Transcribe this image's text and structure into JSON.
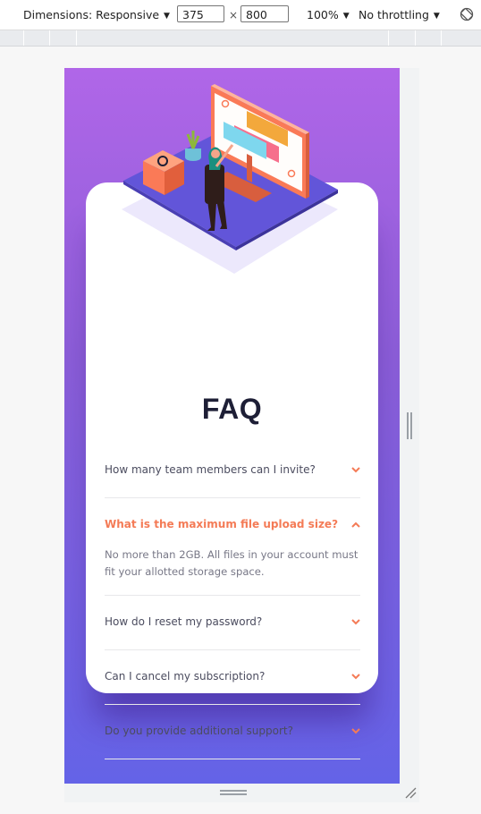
{
  "devtools": {
    "dimensions_label": "Dimensions: Responsive",
    "width_value": "375",
    "times_sign": "×",
    "height_value": "800",
    "zoom": "100%",
    "throttling": "No throttling",
    "dropdown_arrow": "▼"
  },
  "page": {
    "title": "FAQ",
    "accent_color": "#f47b56",
    "gradient_top": "#b066e8",
    "gradient_bottom": "#6463e7",
    "faqs": [
      {
        "question": "How many team members can I invite?",
        "expanded": false
      },
      {
        "question": "What is the maximum file upload size?",
        "expanded": true,
        "answer": "No more than 2GB. All files in your account must fit your allotted storage space."
      },
      {
        "question": "How do I reset my password?",
        "expanded": false
      },
      {
        "question": "Can I cancel my subscription?",
        "expanded": false
      },
      {
        "question": "Do you provide additional support?",
        "expanded": false
      }
    ]
  }
}
